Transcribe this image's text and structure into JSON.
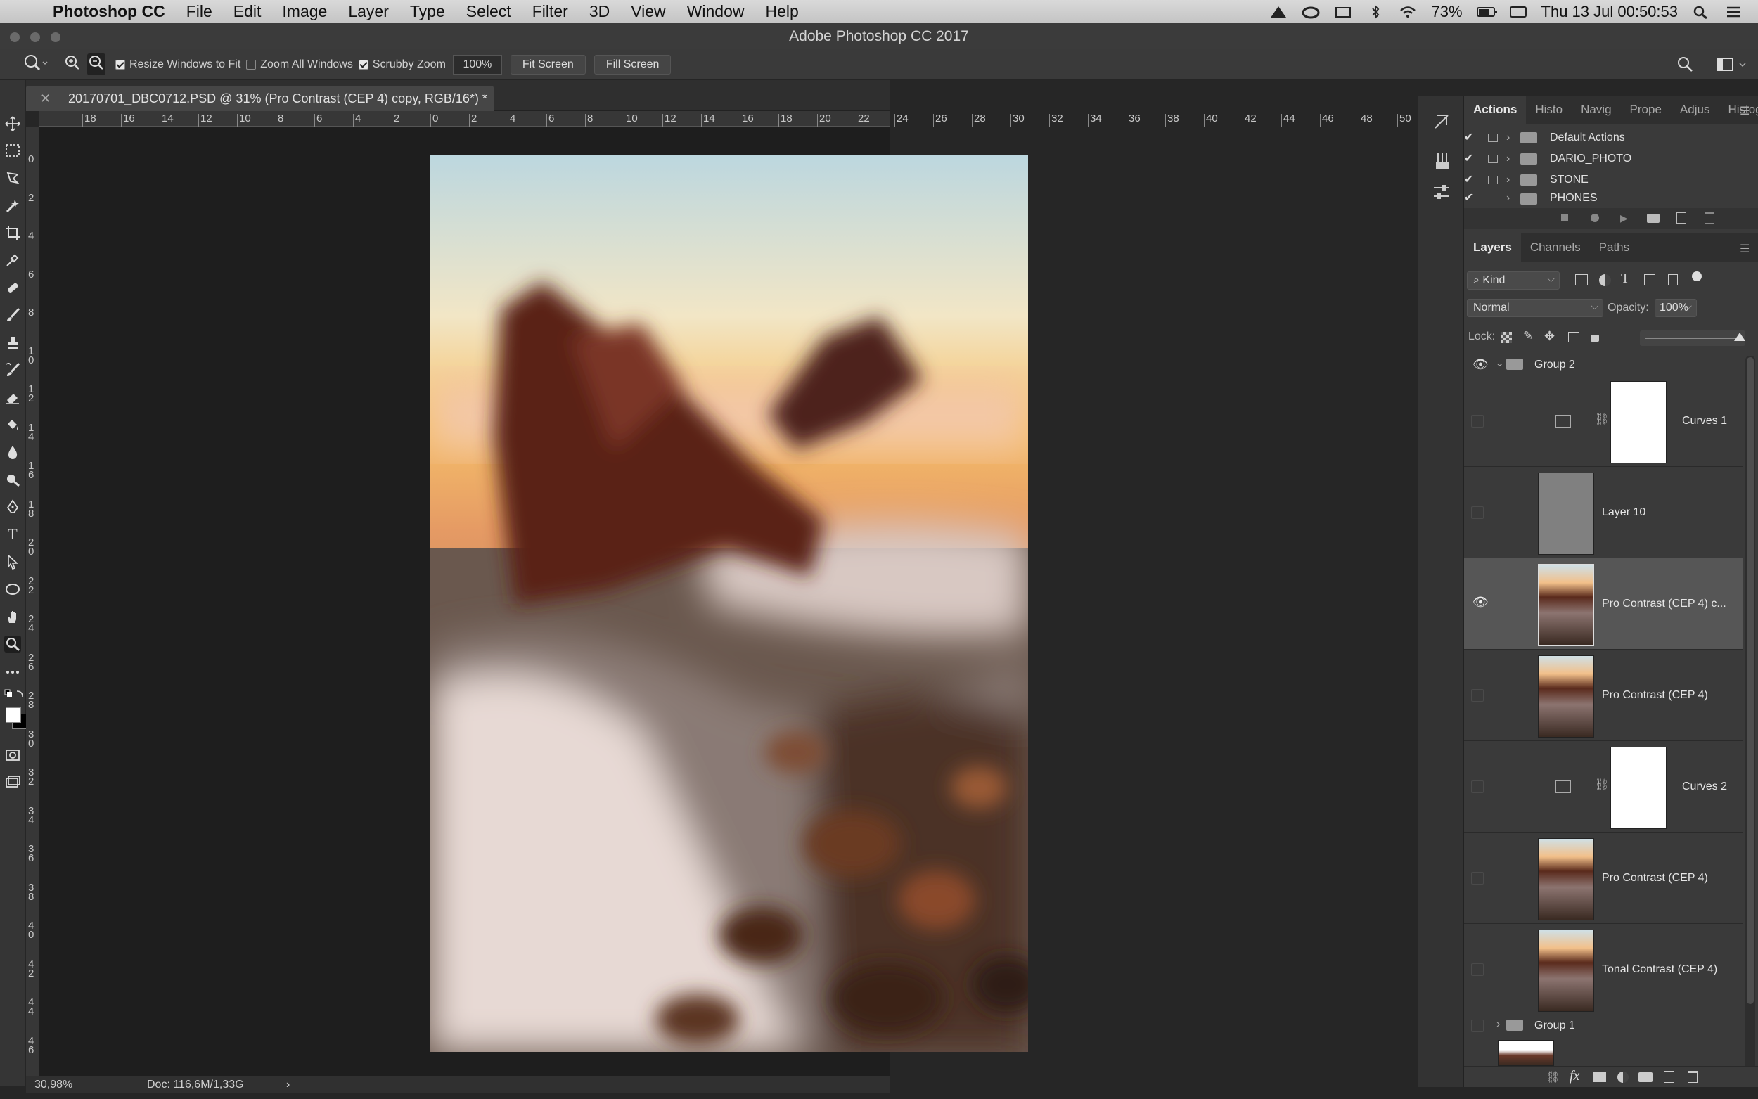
{
  "menubar": {
    "app": "Photoshop CC",
    "items": [
      "File",
      "Edit",
      "Image",
      "Layer",
      "Type",
      "Select",
      "Filter",
      "3D",
      "View",
      "Window",
      "Help"
    ],
    "battery": "73%",
    "datetime": "Thu 13 Jul  00:50:53"
  },
  "window": {
    "title": "Adobe Photoshop CC 2017"
  },
  "options": {
    "resize_windows": "Resize Windows to Fit",
    "zoom_all": "Zoom All Windows",
    "scrubby": "Scrubby Zoom",
    "zoom_value": "100%",
    "fit_screen": "Fit Screen",
    "fill_screen": "Fill Screen"
  },
  "doc": {
    "tab_title": "20170701_DBC0712.PSD @ 31% (Pro Contrast (CEP 4) copy, RGB/16*) *",
    "zoom": "30,98%",
    "doc_size": "Doc: 116,6M/1,33G"
  },
  "hruler": [
    "18",
    "16",
    "14",
    "12",
    "10",
    "8",
    "6",
    "4",
    "2",
    "0",
    "2",
    "4",
    "6",
    "8",
    "10",
    "12",
    "14",
    "16",
    "18",
    "20",
    "22",
    "24",
    "26",
    "28",
    "30",
    "32",
    "34",
    "36",
    "38",
    "40",
    "42",
    "44",
    "46",
    "48",
    "50"
  ],
  "vruler": [
    "0",
    "2",
    "4",
    "6",
    "8",
    "1 0",
    "1 2",
    "1 4",
    "1 6",
    "1 8",
    "2 0",
    "2 2",
    "2 4",
    "2 6",
    "2 8",
    "3 0",
    "3 2",
    "3 4",
    "3 6",
    "3 8",
    "4 0",
    "4 2",
    "4 4",
    "4 6"
  ],
  "actions": {
    "tabs": [
      "Actions",
      "Histo",
      "Navig",
      "Prope",
      "Adjus",
      "Histog"
    ],
    "sets": [
      "Default Actions",
      "DARIO_PHOTO",
      "STONE",
      "PHONES"
    ]
  },
  "layers_panel": {
    "tabs": [
      "Layers",
      "Channels",
      "Paths"
    ],
    "kind": "Kind",
    "blend": "Normal",
    "opacity_label": "Opacity:",
    "opacity": "100%",
    "lock_label": "Lock:",
    "layers": [
      {
        "name": "Group 2",
        "type": "group"
      },
      {
        "name": "Curves 1",
        "type": "adjust"
      },
      {
        "name": "Layer 10",
        "type": "gray"
      },
      {
        "name": "Pro Contrast (CEP 4) c...",
        "type": "photo",
        "selected": true
      },
      {
        "name": "Pro Contrast (CEP 4)",
        "type": "photo"
      },
      {
        "name": "Curves 2",
        "type": "adjust"
      },
      {
        "name": "Pro Contrast (CEP 4)",
        "type": "photo"
      },
      {
        "name": "Tonal Contrast (CEP 4)",
        "type": "photo"
      },
      {
        "name": "Group 1",
        "type": "group"
      }
    ]
  },
  "colors": {
    "ui_dark": "#262626",
    "panel": "#3a3a3a",
    "selected_row": "#565656"
  }
}
